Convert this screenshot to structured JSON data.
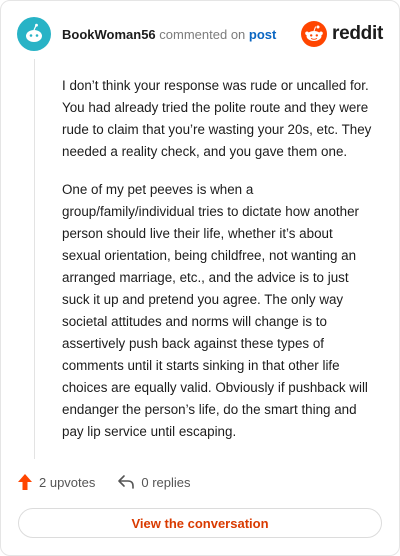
{
  "header": {
    "username": "BookWoman56",
    "verb": "commented on",
    "post_link": "post",
    "brand_name": "reddit",
    "brand_color": "#ff4500"
  },
  "comment": {
    "paragraphs": [
      "I don’t think your response was rude or uncalled for. You had already tried the polite route and they were rude to claim that you’re wasting your 20s, etc. They needed a reality check, and you gave them one.",
      "One of my pet peeves is when a group/family/individual tries to dictate how another person should live their life, whether it’s about sexual orientation, being childfree, not wanting an arranged marriage, etc., and the advice is to just suck it up and pretend you agree. The only way societal attitudes and norms will change is to assertively push back against these types of comments until it starts sinking in that other life choices are equally valid. Obviously if pushback will endanger the person’s life, do the smart thing and pay lip service until escaping."
    ]
  },
  "actions": {
    "upvotes_label": "2 upvotes",
    "upvote_icon": "upvote-arrow-icon",
    "upvote_color": "#ff4500",
    "replies_label": "0 replies",
    "reply_icon": "reply-arrow-icon"
  },
  "cta": {
    "label": "View the conversation",
    "color": "#d93a00"
  }
}
